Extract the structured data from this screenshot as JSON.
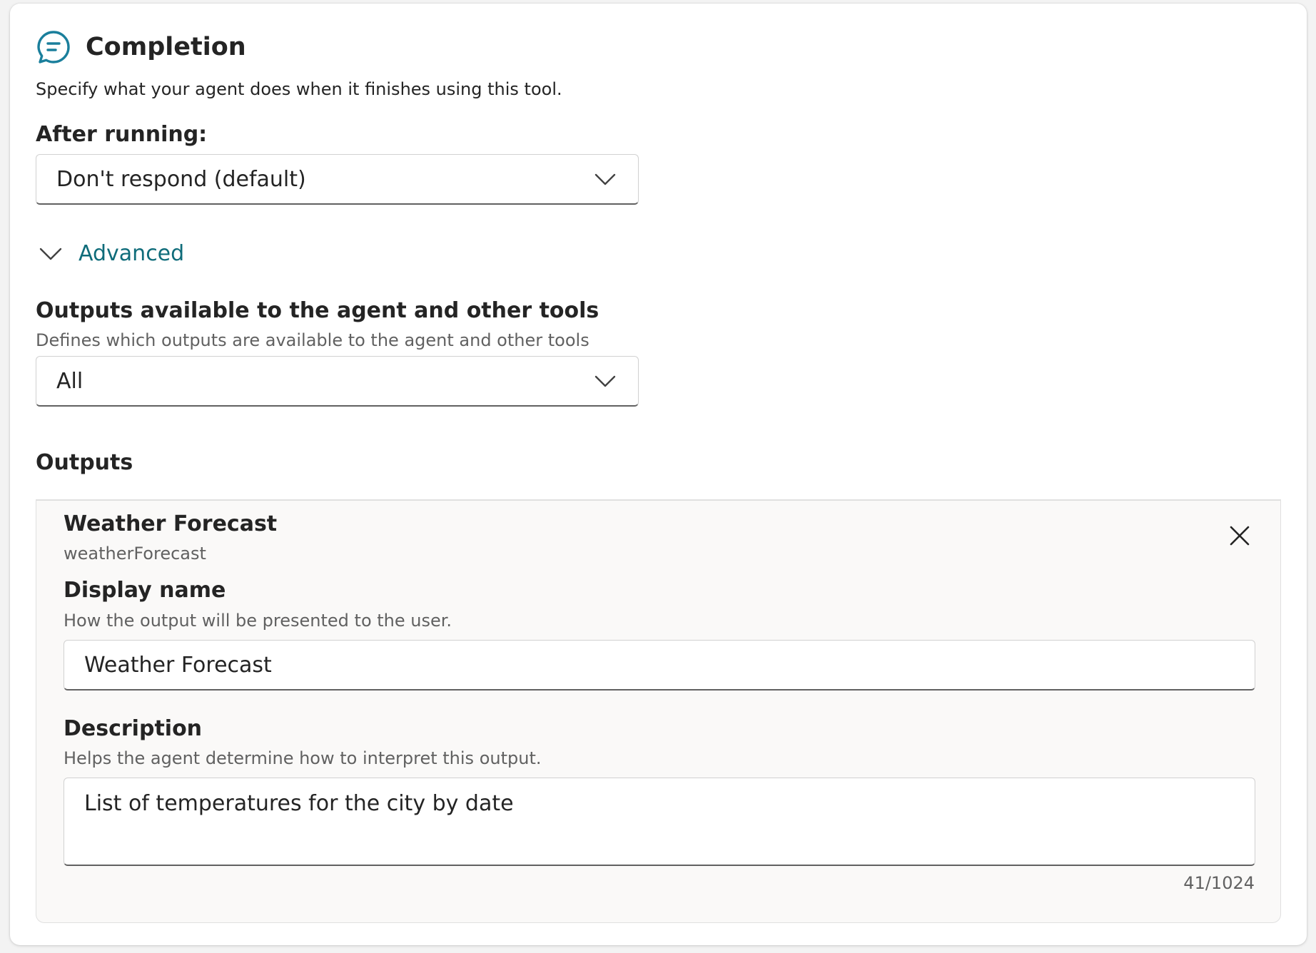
{
  "section": {
    "title": "Completion",
    "icon": "chat-bubble-icon",
    "subtitle": "Specify what your agent does when it finishes using this tool."
  },
  "after_running": {
    "label": "After running:",
    "selected": "Don't respond (default)"
  },
  "advanced": {
    "label": "Advanced",
    "expanded": true
  },
  "outputs_available": {
    "label": "Outputs available to the agent and other tools",
    "hint": "Defines which outputs are available to the agent and other tools",
    "selected": "All"
  },
  "outputs": {
    "heading": "Outputs",
    "items": [
      {
        "title": "Weather Forecast",
        "id": "weatherForecast",
        "display_name_label": "Display name",
        "display_name_hint": "How the output will be presented to the user.",
        "display_name_value": "Weather Forecast",
        "description_label": "Description",
        "description_hint": "Helps the agent determine how to interpret this output.",
        "description_value": "List of temperatures for the city by date",
        "char_count": "41/1024"
      }
    ]
  },
  "colors": {
    "accent": "#0f6c7a",
    "icon": "#1a7f9c",
    "text": "#242424",
    "secondary_text": "#616161",
    "panel_bg": "#faf9f8"
  }
}
